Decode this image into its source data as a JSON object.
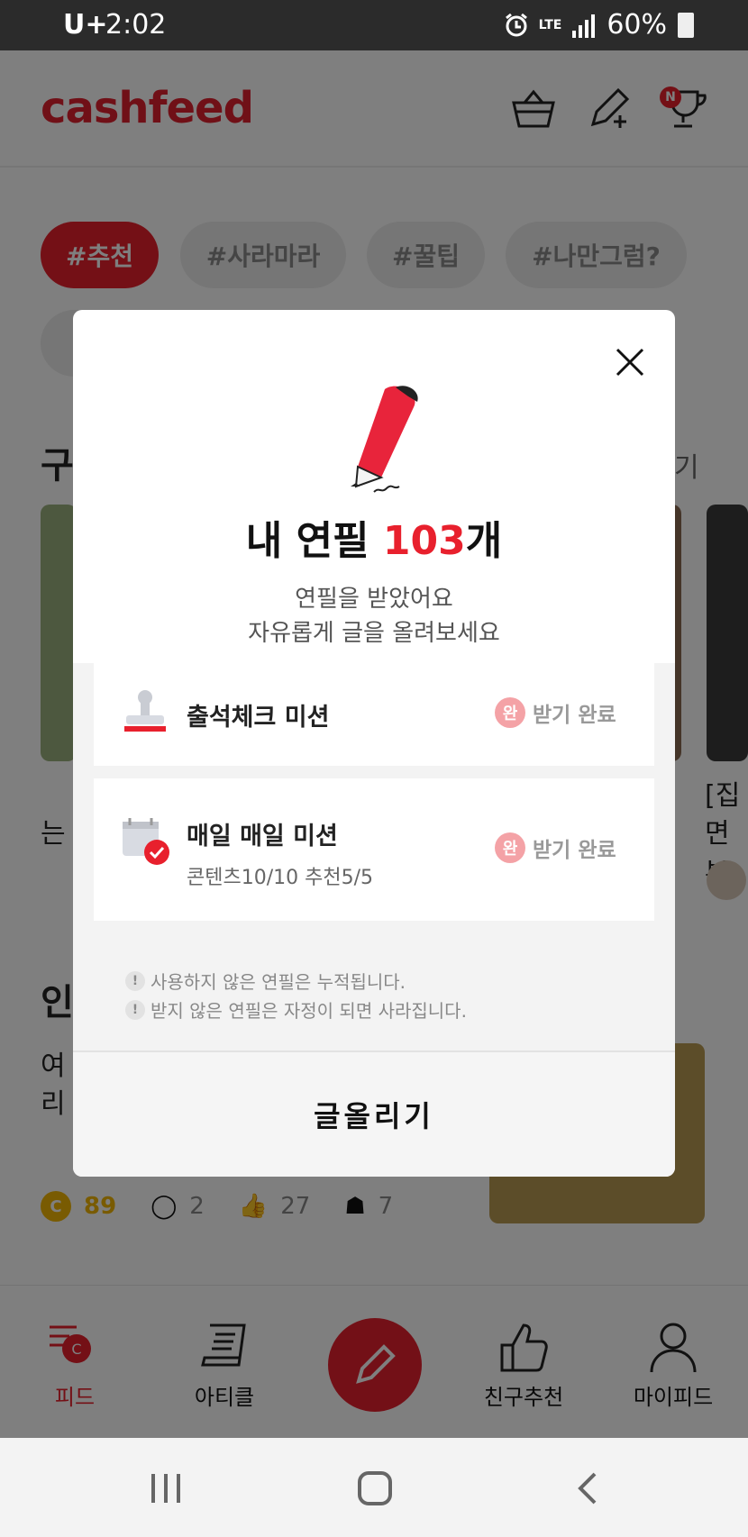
{
  "status_bar": {
    "carrier": "U+",
    "time": "2:02",
    "network": "LTE",
    "battery": "60%"
  },
  "header": {
    "logo": "cashfeed",
    "trophy_badge": "N"
  },
  "tags": [
    "#추천",
    "#사라마라",
    "#꿀팁",
    "#나만그럼?"
  ],
  "feed": {
    "section_partial": "구",
    "more_partial": "기",
    "card1_partial": "는",
    "card2_partial_1": "[집",
    "card2_partial_2": "면 부",
    "section2_partial": "인",
    "line1_partial": "여",
    "line2_partial": "리",
    "stats": {
      "points": "89",
      "comments": "2",
      "likes": "27",
      "pins": "7"
    }
  },
  "modal": {
    "title_prefix": "내 연필 ",
    "title_count": "103",
    "title_suffix": "개",
    "subtitle_line1": "연필을 받았어요",
    "subtitle_line2": "자유롭게 글을 올려보세요",
    "missions": [
      {
        "name": "출석체크 미션",
        "badge": "완",
        "status": "받기 완료"
      },
      {
        "name": "매일 매일 미션",
        "desc": "콘텐츠10/10  추천5/5",
        "badge": "완",
        "status": "받기 완료"
      }
    ],
    "notes": [
      "사용하지 않은 연필은 누적됩니다.",
      "받지 않은 연필은 자정이 되면 사라집니다."
    ],
    "note_bang": "!",
    "submit_label": "글올리기"
  },
  "bottom_nav": {
    "feed": "피드",
    "article": "아티클",
    "friends": "친구추천",
    "myfeed": "마이피드"
  },
  "colors": {
    "brand": "#e8202d",
    "badge": "#f4a2a6"
  }
}
